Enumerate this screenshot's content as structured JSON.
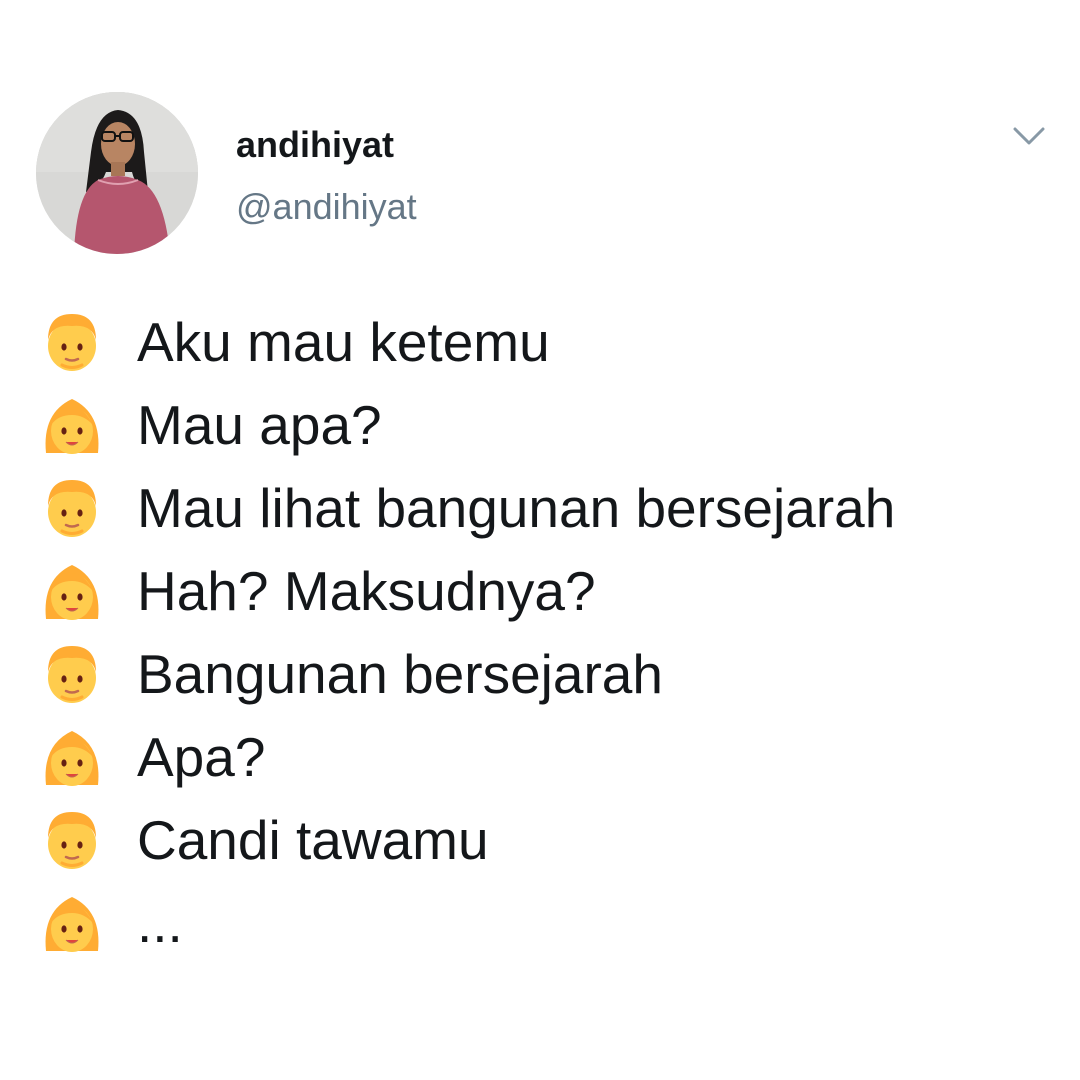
{
  "tweet": {
    "display_name": "andihiyat",
    "handle": "@andihiyat",
    "menu_icon": "chevron-down-icon",
    "avatar": "profile-photo",
    "lines": [
      {
        "speaker": "man-emoji",
        "text": "Aku mau ketemu"
      },
      {
        "speaker": "woman-emoji",
        "text": "Mau apa?"
      },
      {
        "speaker": "man-emoji",
        "text": "Mau lihat bangunan bersejarah"
      },
      {
        "speaker": "woman-emoji",
        "text": "Hah? Maksudnya?"
      },
      {
        "speaker": "man-emoji",
        "text": "Bangunan bersejarah"
      },
      {
        "speaker": "woman-emoji",
        "text": "Apa?"
      },
      {
        "speaker": "man-emoji",
        "text": "Candi tawamu"
      },
      {
        "speaker": "woman-emoji",
        "text": "..."
      }
    ]
  },
  "colors": {
    "name_text": "#14171a",
    "handle_text": "#657786",
    "emoji_skin": "#ffcc4d",
    "emoji_hair": "#ffac33"
  }
}
